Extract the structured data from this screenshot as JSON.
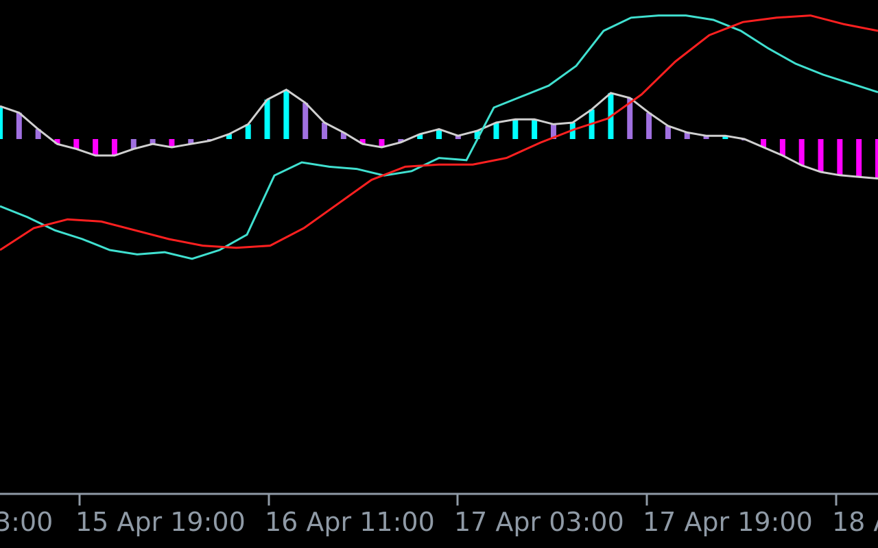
{
  "chart_data": {
    "type": "line",
    "title": "",
    "xlabel": "",
    "ylabel": "",
    "grid": false,
    "legend": "none",
    "x_ticks": [
      "3:00",
      "15 Apr 19:00",
      "16 Apr 11:00",
      "17 Apr 03:00",
      "17 Apr 19:00",
      "18 A"
    ],
    "x": [
      0,
      2,
      4,
      6,
      8,
      10,
      12,
      14,
      16,
      18,
      20,
      22,
      24,
      26,
      28,
      30,
      32,
      34,
      36,
      38,
      40,
      42,
      44,
      46,
      48,
      50,
      52,
      54,
      56,
      58,
      60,
      62,
      64,
      66,
      68,
      70,
      72,
      74,
      76,
      78,
      80,
      82,
      84,
      86,
      88,
      90,
      92
    ],
    "ylim": [
      -25,
      6
    ],
    "series": [
      {
        "name": "",
        "role": "histogram",
        "color": "#ff00ff",
        "values": [
          2.0,
          1.6,
          0.6,
          -0.3,
          -0.6,
          -1.0,
          -1.0,
          -0.6,
          -0.3,
          -0.5,
          -0.3,
          -0.1,
          0.3,
          0.9,
          2.4,
          3.0,
          2.2,
          1.0,
          0.4,
          -0.3,
          -0.5,
          -0.2,
          0.3,
          0.6,
          0.2,
          0.5,
          1.0,
          1.2,
          1.2,
          0.9,
          1.0,
          1.8,
          2.8,
          2.5,
          1.6,
          0.8,
          0.4,
          0.2,
          0.2,
          0.0,
          -0.5,
          -1.0,
          -1.6,
          -2.0,
          -2.2,
          -2.3,
          -2.4
        ]
      },
      {
        "name": "",
        "role": "main",
        "color": "#40e0d0",
        "values": [
          -3.0,
          -3.5,
          -4.1,
          -4.5,
          -5.0,
          -5.2,
          -5.1,
          -5.4,
          -5.0,
          -4.3,
          -1.6,
          -1.0,
          -1.2,
          -1.3,
          -1.6,
          -1.4,
          -0.8,
          -0.9,
          1.5,
          2.0,
          2.5,
          3.4,
          5.0,
          5.6,
          5.7,
          5.7,
          5.5,
          5.0,
          4.2,
          3.5,
          3.0,
          2.6,
          2.2
        ]
      },
      {
        "name": "",
        "role": "signal",
        "color": "#ff2020",
        "values": [
          -5.0,
          -4.0,
          -3.6,
          -3.7,
          -4.1,
          -4.5,
          -4.8,
          -4.9,
          -4.8,
          -4.0,
          -2.9,
          -1.8,
          -1.2,
          -1.1,
          -1.1,
          -0.8,
          -0.1,
          0.5,
          1.0,
          2.1,
          3.6,
          4.8,
          5.4,
          5.6,
          5.7,
          5.3,
          5.0
        ]
      }
    ]
  }
}
